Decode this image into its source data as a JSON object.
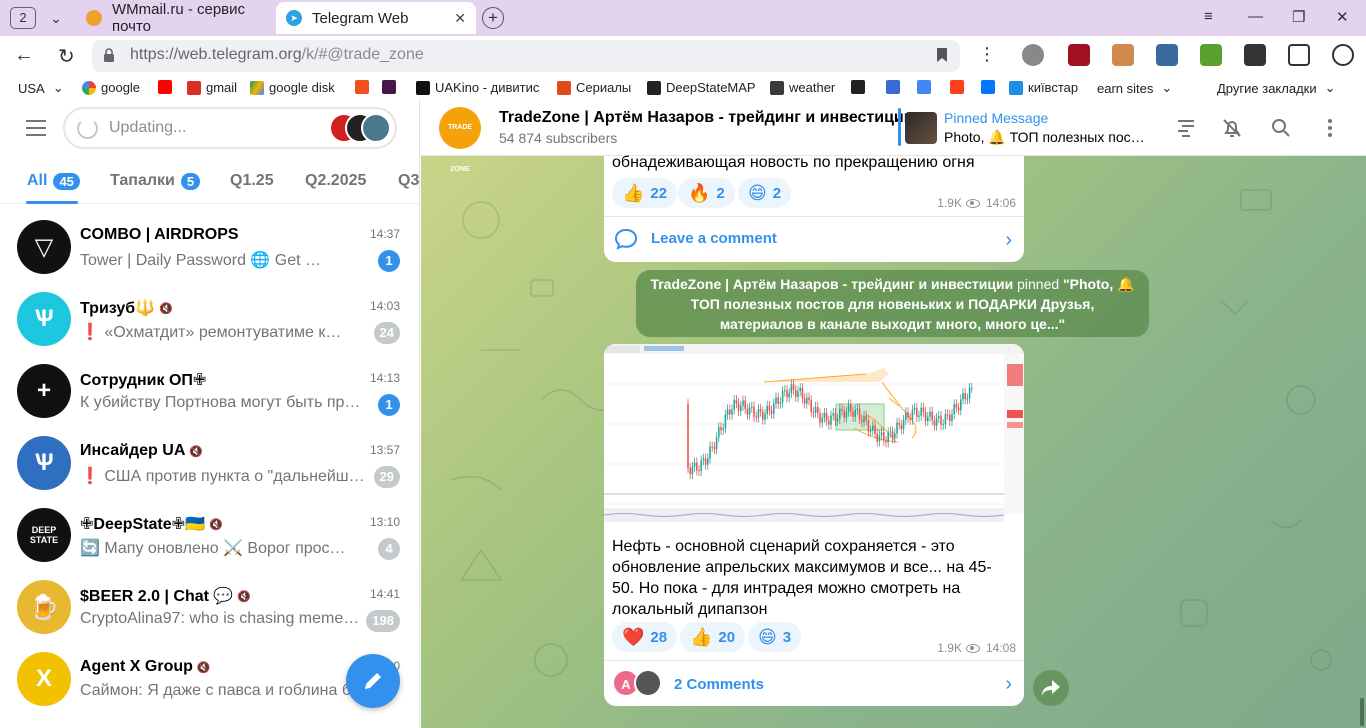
{
  "browser": {
    "tab_count": "2",
    "tabs": [
      {
        "title": "WMmail.ru - сервис почто",
        "icon": "wmmail-icon"
      },
      {
        "title": "Telegram Web",
        "icon": "telegram-icon"
      }
    ],
    "url_host": "https://web.telegram.org",
    "url_path": "/k/#@trade_zone",
    "bookmarks": [
      {
        "label": "USA",
        "icon": "chevron-down-icon"
      },
      {
        "label": "google",
        "icon": "google-icon"
      },
      {
        "label": "",
        "icon": "youtube-icon"
      },
      {
        "label": "gmail",
        "icon": "gmail-icon"
      },
      {
        "label": "google disk",
        "icon": "google-drive-icon"
      },
      {
        "label": "",
        "icon": "figma-icon"
      },
      {
        "label": "",
        "icon": "slack-icon"
      },
      {
        "label": "UAKino - дивитис",
        "icon": "uakino-icon"
      },
      {
        "label": "Сериалы",
        "icon": "series-icon"
      },
      {
        "label": "DeepStateMAP",
        "icon": "deepstate-icon"
      },
      {
        "label": "weather",
        "icon": "weather-icon"
      },
      {
        "label": "",
        "icon": "bc-icon"
      },
      {
        "label": "",
        "icon": "kb-icon"
      },
      {
        "label": "",
        "icon": "translate-icon"
      },
      {
        "label": "",
        "icon": "yandex-icon"
      },
      {
        "label": "",
        "icon": "vk-icon"
      },
      {
        "label": "київстар",
        "icon": "kyivstar-icon"
      },
      {
        "label": "earn sites",
        "icon": "chevron-down-icon"
      }
    ],
    "other_bookmarks": "Другие закладки"
  },
  "sidebar": {
    "search_placeholder": "Updating...",
    "folders": [
      {
        "label": "All",
        "badge": "45"
      },
      {
        "label": "Тапалки",
        "badge": "5"
      },
      {
        "label": "Q1.25",
        "badge": ""
      },
      {
        "label": "Q2.2025",
        "badge": ""
      },
      {
        "label": "Q3.",
        "badge": ""
      }
    ],
    "chats": [
      {
        "name": "COMBO | AIRDROPS",
        "time": "14:37",
        "preview": "Tower | Daily Password 🌐 Get …",
        "badge": "1",
        "unread": true,
        "muted": false,
        "avatar_color": "#111111",
        "avatar_glyph": "▽",
        "prefix": ""
      },
      {
        "name": "Тризуб🔱",
        "time": "14:03",
        "preview": "«Охматдит» ремонтуватиме к…",
        "badge": "24",
        "unread": false,
        "muted": true,
        "avatar_color": "#1ec7e0",
        "avatar_glyph": "Ѱ",
        "prefix": "❗"
      },
      {
        "name": "Сотрудник ОП✙",
        "time": "14:13",
        "preview": "К убийству Портнова могут быть при…",
        "badge": "1",
        "unread": true,
        "muted": false,
        "avatar_color": "#111111",
        "avatar_glyph": "+",
        "prefix": ""
      },
      {
        "name": "Инсайдер UA",
        "time": "13:57",
        "preview": "США против пункта о \"дальнейш…",
        "badge": "29",
        "unread": false,
        "muted": true,
        "avatar_color": "#2f6fbf",
        "avatar_glyph": "Ѱ",
        "prefix": "❗"
      },
      {
        "name": "✙DeepState✙🇺🇦",
        "time": "13:10",
        "preview": "🔄 Мапу оновлено ⚔️ Ворог прос…",
        "badge": "4",
        "unread": false,
        "muted": true,
        "avatar_color": "#111111",
        "avatar_glyph": "DEEP STATE",
        "prefix": ""
      },
      {
        "name": "$BEER 2.0 | Chat 💬",
        "time": "14:41",
        "preview": "CryptoAlina97: who is chasing meme…",
        "badge": "198",
        "unread": false,
        "muted": true,
        "avatar_color": "#e8b830",
        "avatar_glyph": "🍺",
        "prefix": ""
      },
      {
        "name": "Agent X Group",
        "time": "14:30",
        "preview": "Саймон: Я даже с павса и гоблина б…",
        "badge": "",
        "unread": false,
        "muted": true,
        "avatar_color": "#f2c200",
        "avatar_glyph": "X",
        "prefix": ""
      }
    ]
  },
  "channel": {
    "name": "TradeZone | Артём Назаров - трейдинг и инвестиции",
    "subscribers": "54 874 subscribers",
    "avatar_text": "TRADE ZONE",
    "pinned_title": "Pinned Message",
    "pinned_text": "Photo, 🔔 ТОП полезных пост…"
  },
  "messages": {
    "prev": {
      "tail_text": "обнадеживающая новость по прекращению огня",
      "reactions": [
        {
          "emoji": "👍",
          "count": "22"
        },
        {
          "emoji": "🔥",
          "count": "2"
        },
        {
          "emoji": "😄",
          "count": "2"
        }
      ],
      "views": "1.9K",
      "time": "14:06",
      "comment_label": "Leave a comment"
    },
    "service": {
      "actor": "TradeZone | Артём Назаров - трейдинг и инвестиции",
      "pinned_word": "pinned",
      "quote": "\"Photo, 🔔 ТОП полезных постов для новеньких и ПОДАРКИ Друзья, материалов в канале выходит много, много це...\""
    },
    "post": {
      "text": "Нефть - основной сценарий сохраняется - это обновление апрельских максимумов и все... на 45-50. Но пока - для интрадея можно смотреть на локальный дипапзон",
      "reactions": [
        {
          "emoji": "❤️",
          "count": "28"
        },
        {
          "emoji": "👍",
          "count": "20"
        },
        {
          "emoji": "😄",
          "count": "3"
        }
      ],
      "views": "1.9K",
      "time": "14:08",
      "comment_avatar_letter": "A",
      "comment_label": "2 Comments"
    }
  },
  "colors": {
    "accent": "#3390ec",
    "badge_muted": "#c4c9cc",
    "bull_candle": "#26a69a",
    "bear_candle": "#ef5350"
  }
}
